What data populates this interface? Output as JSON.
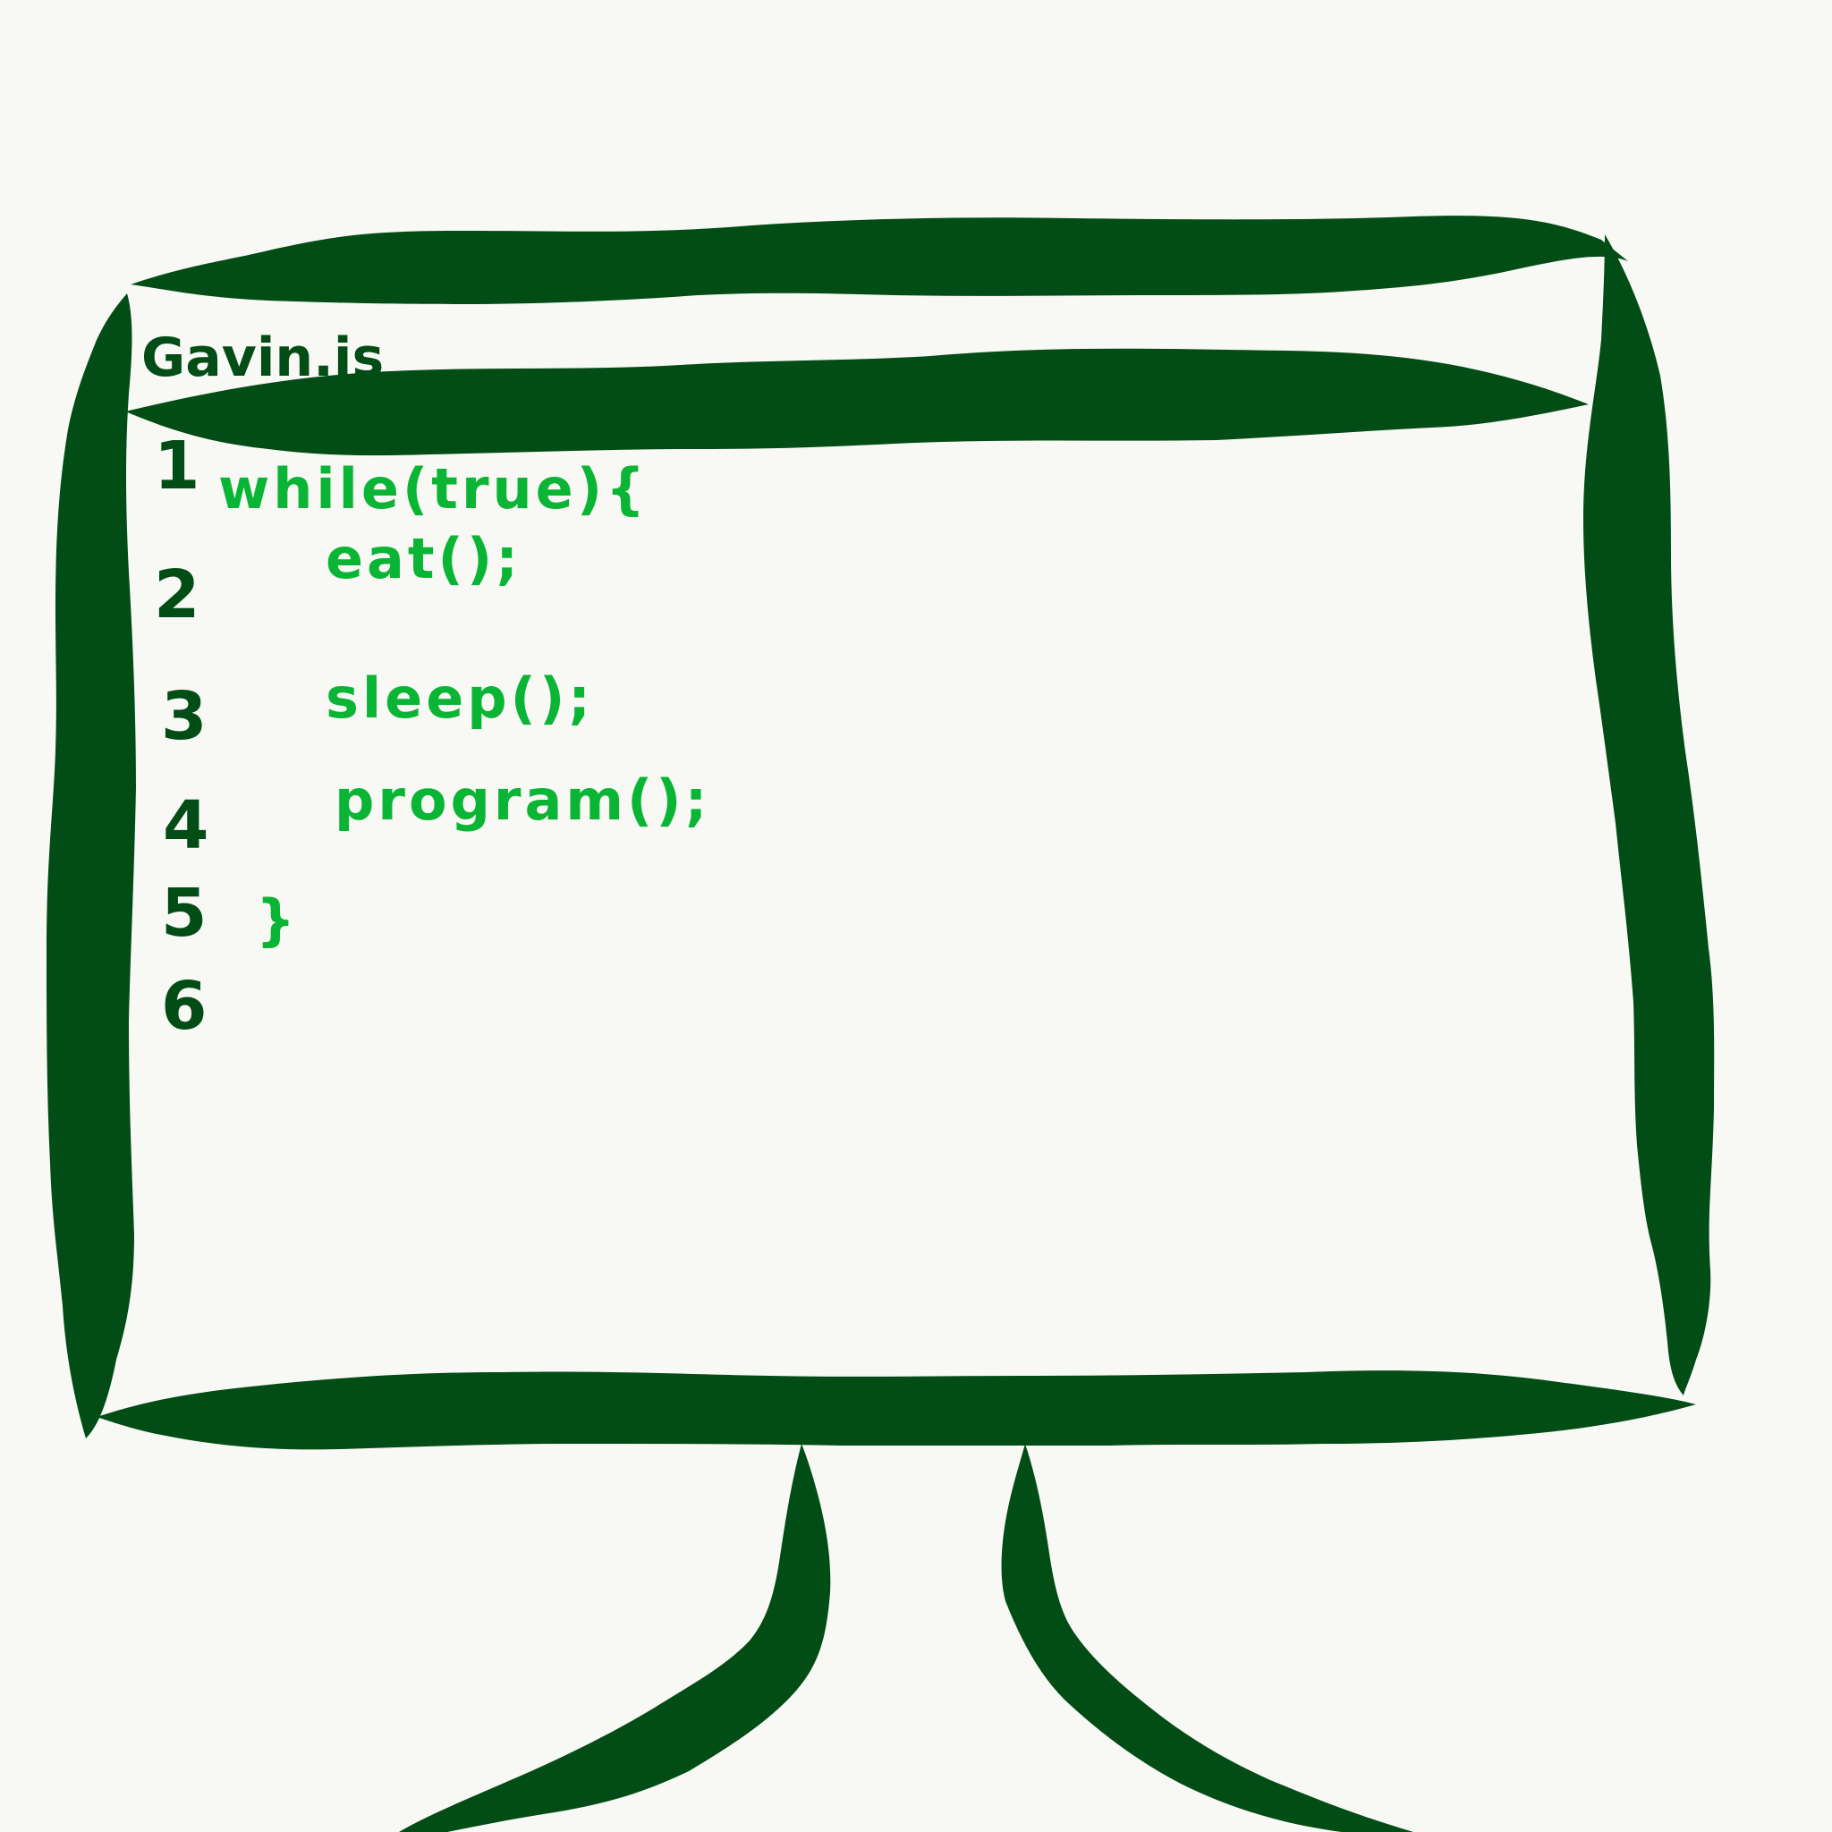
{
  "colors": {
    "background": "#f8f8f4",
    "outline": "#024c16",
    "code_text": "#0ab434",
    "line_numbers": "#024c16"
  },
  "editor": {
    "file_name": "Gavin.js",
    "line_numbers": [
      "1",
      "2",
      "3",
      "4",
      "5",
      "6"
    ],
    "code_lines": [
      "while(true){",
      "eat();",
      "sleep();",
      "program();",
      "}",
      ""
    ]
  }
}
